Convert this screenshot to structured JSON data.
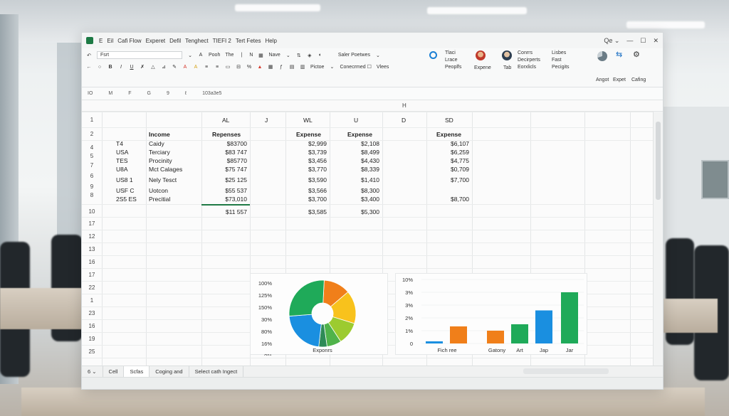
{
  "app": {
    "icon_label": "",
    "menu": [
      "E",
      "Eil",
      "Cafi Flow",
      "Experet",
      "Defil",
      "Tenghect",
      "TIEFI 2",
      "Tert Fetes",
      "Help"
    ],
    "window_controls": [
      "Qe ⌄",
      "—",
      "☐",
      "✕"
    ]
  },
  "ribbon": {
    "font_box": "Fsrt",
    "paste_label": "Pooh",
    "the_label": "The",
    "n_label": "N",
    "nave_label": "Nave",
    "styles_label": "Saler Poetwes",
    "cond_label": "Conecrmed ☐",
    "views_label": "Vlees",
    "pictoe_label": "Pictoe",
    "g1": [
      "Tlaci",
      "Lrace",
      "Peoplfs"
    ],
    "expene_label": "Expene",
    "tab_label": "Tab",
    "g2": [
      "Conrrs",
      "Decirperts",
      "Eorxlicls"
    ],
    "g3": [
      "Lisbes",
      "Fast",
      "Pecigits"
    ],
    "right": [
      "Angot",
      "Expet",
      "Cafing"
    ]
  },
  "formula_bar": {
    "items": [
      "IO",
      "M",
      "F",
      "G",
      "9",
      "ℓ",
      "103a3e5"
    ]
  },
  "column_bar": {
    "label": "H"
  },
  "sheet": {
    "col_headers": [
      "AL",
      "J",
      "WL",
      "U",
      "D",
      "SD"
    ],
    "row_numbers": [
      "1",
      "2",
      "4",
      "5",
      "7",
      "6",
      "9",
      "8",
      "9",
      "10",
      "17",
      "12",
      "13",
      "16",
      "17",
      "22",
      "1",
      "23",
      "16",
      "19",
      "25"
    ],
    "headers": {
      "b": "Income",
      "c": "Repenses",
      "e": "Expense",
      "f": "Expense",
      "h": "Expense"
    },
    "rows": [
      {
        "a": "T4",
        "b": "Caidy",
        "c": "$83700",
        "e": "$2,999",
        "f": "$2,108",
        "h": "$6,107"
      },
      {
        "a": "USA",
        "b": "Terciary",
        "c": "$83 747",
        "e": "$3,739",
        "f": "$8,499",
        "h": "$6,259"
      },
      {
        "a": "TES",
        "b": "Procinity",
        "c": "$85770",
        "e": "$3,456",
        "f": "$4,430",
        "h": "$4,775"
      },
      {
        "a": "U8A",
        "b": "Mct Calages",
        "c": "$75 747",
        "e": "$3,770",
        "f": "$8,339",
        "h": "$0,709"
      },
      {
        "a": "US8 1",
        "b": "Nely Tesct",
        "c": "$25 125",
        "e": "$3,590",
        "f": "$1,410",
        "h": "$7,700"
      },
      {
        "a": "USF C",
        "b": "Uotcon",
        "c": "$55 537",
        "e": "$3,566",
        "f": "$8,300",
        "h": ""
      },
      {
        "a": "2S5 ES",
        "b": "Precitial",
        "c": "$73,010",
        "e": "$3,700",
        "f": "$3,400",
        "h": "$8,700"
      }
    ],
    "totals": {
      "c": "$11 557",
      "e": "$3,585",
      "f": "$5,300"
    }
  },
  "charts": {
    "donut": {
      "y_ticks": [
        "100%",
        "125%",
        "150%",
        "30%",
        "80%",
        "16%",
        "0%"
      ],
      "label": "Exponrs",
      "colors": [
        "#f07f1a",
        "#f8c21c",
        "#9ccb2f",
        "#4fb34a",
        "#2e8b57",
        "#1a8fe0",
        "#1faa59"
      ]
    },
    "bar": {
      "y_ticks": [
        "10%",
        "3%",
        "3%",
        "2%",
        "1%",
        "0"
      ],
      "x_labels": [
        "Fich ree",
        "Gatony",
        "Art",
        "Jap",
        "Jar"
      ]
    }
  },
  "chart_data": [
    {
      "type": "pie",
      "title": "",
      "categories": [
        "",
        "",
        "",
        "",
        "",
        "",
        ""
      ],
      "values": [
        13,
        16,
        11,
        7,
        4,
        22,
        27
      ],
      "xlabel": "Exponrs"
    },
    {
      "type": "bar",
      "title": "",
      "categories": [
        "Fich ree",
        "",
        "Gatony",
        "Art",
        "Jap",
        "Jar"
      ],
      "values": [
        0.2,
        1.6,
        1.2,
        1.8,
        3.1,
        4.8
      ],
      "colors": [
        "#1a8fe0",
        "#f07f1a",
        "#f07f1a",
        "#1faa59",
        "#1a8fe0",
        "#1faa59"
      ],
      "ylim": [
        0,
        6
      ]
    }
  ],
  "sheet_tabs": [
    "6 ⌄",
    "Cell",
    "Scfas",
    "Coging and",
    "Select cath Ingect"
  ]
}
